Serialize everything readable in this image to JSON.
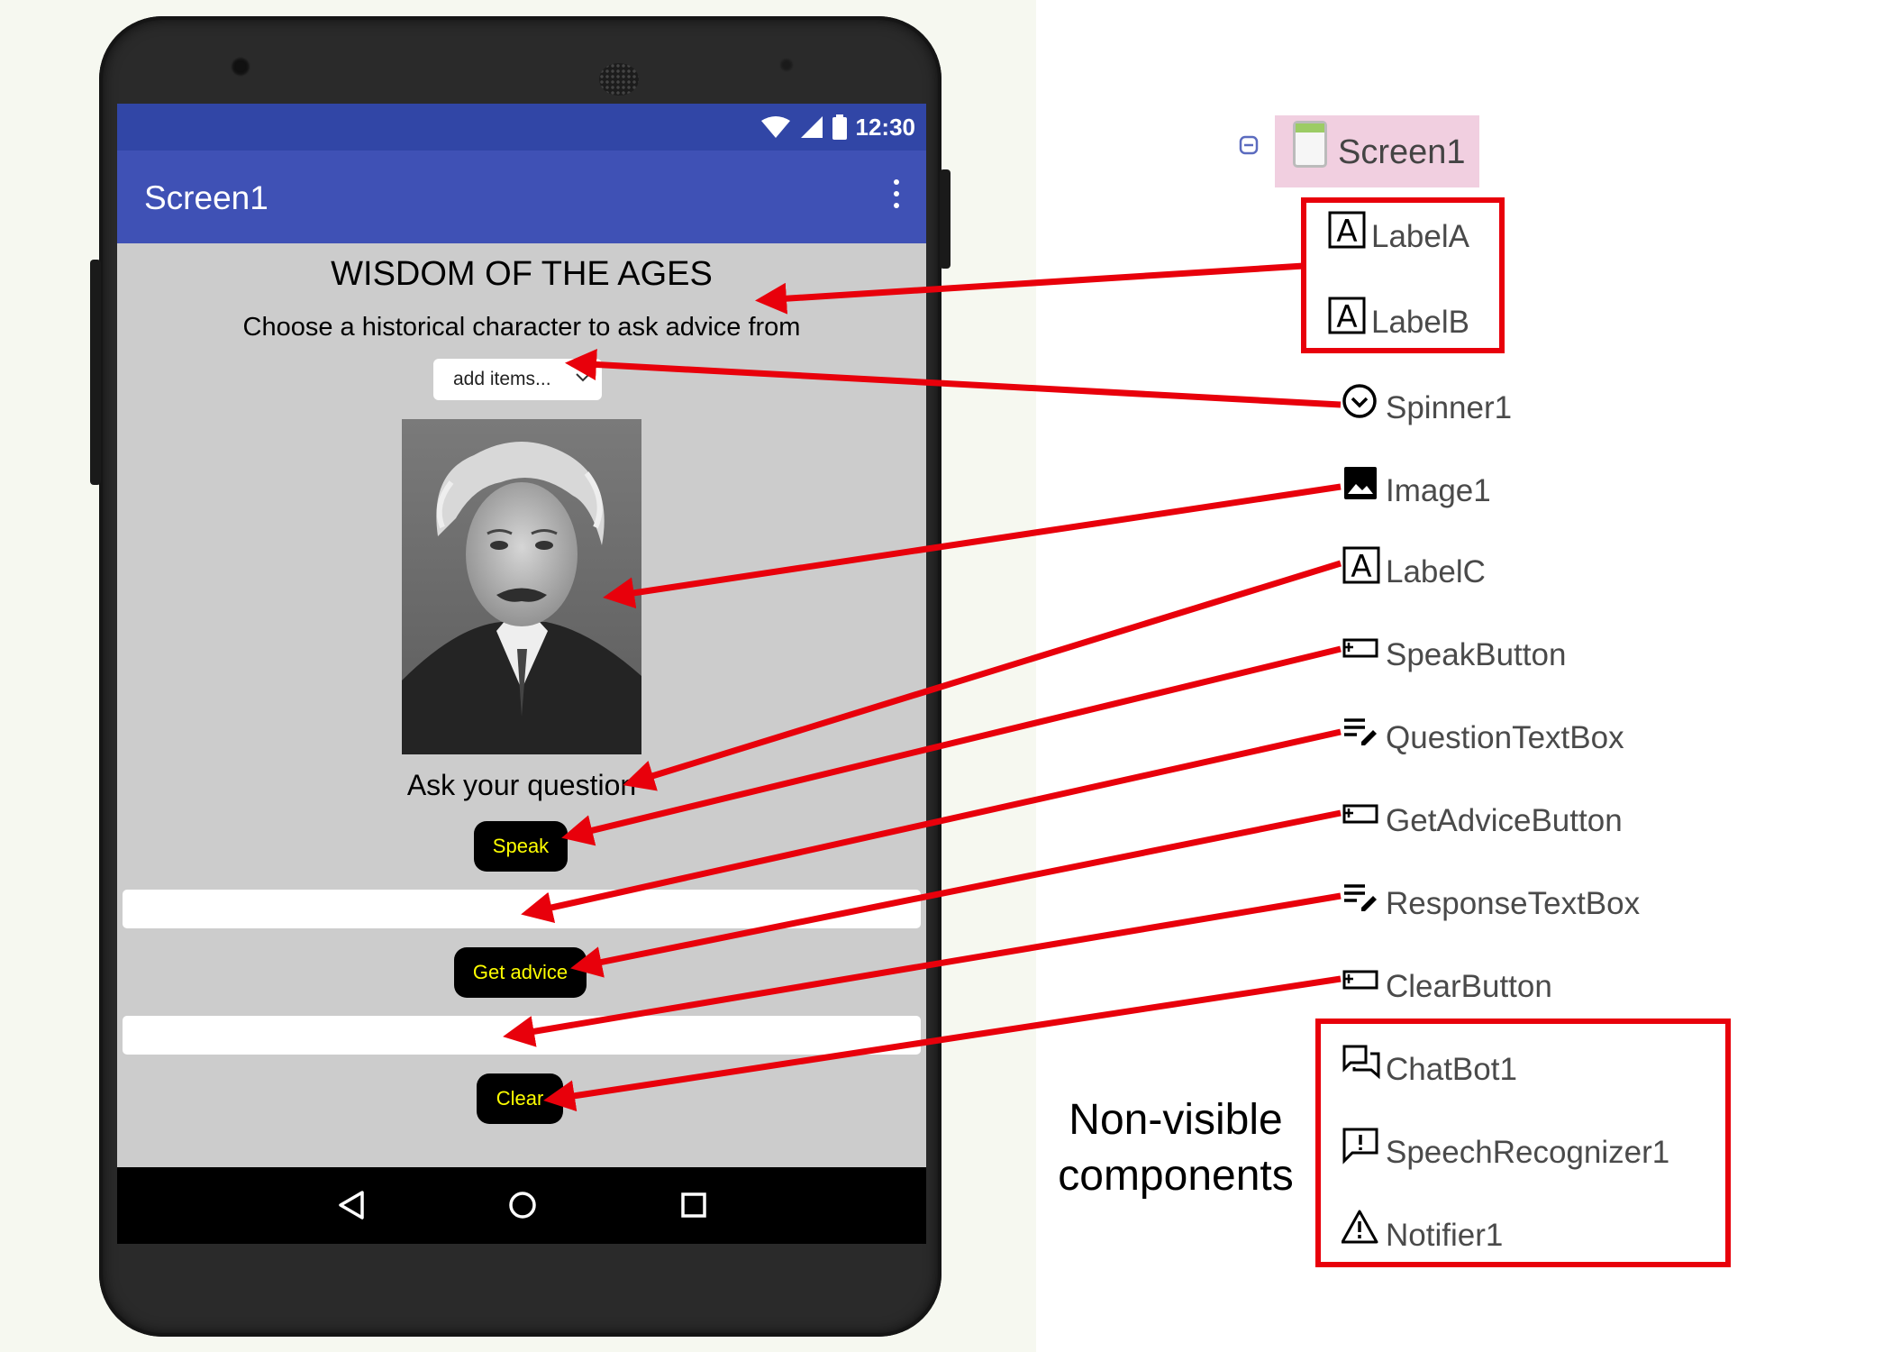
{
  "phone": {
    "status_time": "12:30",
    "app_title": "Screen1",
    "heading": "WISDOM OF THE AGES",
    "subheading": "Choose a historical character to ask advice from",
    "spinner_text": "add items...",
    "ask_label": "Ask your question",
    "speak_label": "Speak",
    "advice_label": "Get advice",
    "clear_label": "Clear"
  },
  "tree": {
    "root": "Screen1",
    "components": [
      {
        "label": "LabelA",
        "icon": "label-icon"
      },
      {
        "label": "LabelB",
        "icon": "label-icon"
      },
      {
        "label": "Spinner1",
        "icon": "spinner-icon"
      },
      {
        "label": "Image1",
        "icon": "image-icon"
      },
      {
        "label": "LabelC",
        "icon": "label-icon"
      },
      {
        "label": "SpeakButton",
        "icon": "button-icon"
      },
      {
        "label": "QuestionTextBox",
        "icon": "textbox-icon"
      },
      {
        "label": "GetAdviceButton",
        "icon": "button-icon"
      },
      {
        "label": "ResponseTextBox",
        "icon": "textbox-icon"
      },
      {
        "label": "ClearButton",
        "icon": "button-icon"
      },
      {
        "label": "ChatBot1",
        "icon": "chatbot-icon"
      },
      {
        "label": "SpeechRecognizer1",
        "icon": "speech-recognizer-icon"
      },
      {
        "label": "Notifier1",
        "icon": "notifier-icon"
      }
    ]
  },
  "nonvisible_label_line1": "Non-visible",
  "nonvisible_label_line2": "components",
  "colors": {
    "app_bar": "#3f51b5",
    "status_bar": "#3146a6",
    "button_bg": "#000000",
    "button_text": "#ffff00",
    "highlight_red": "#e8000b",
    "screen_node_bg": "#f1cfe0"
  }
}
